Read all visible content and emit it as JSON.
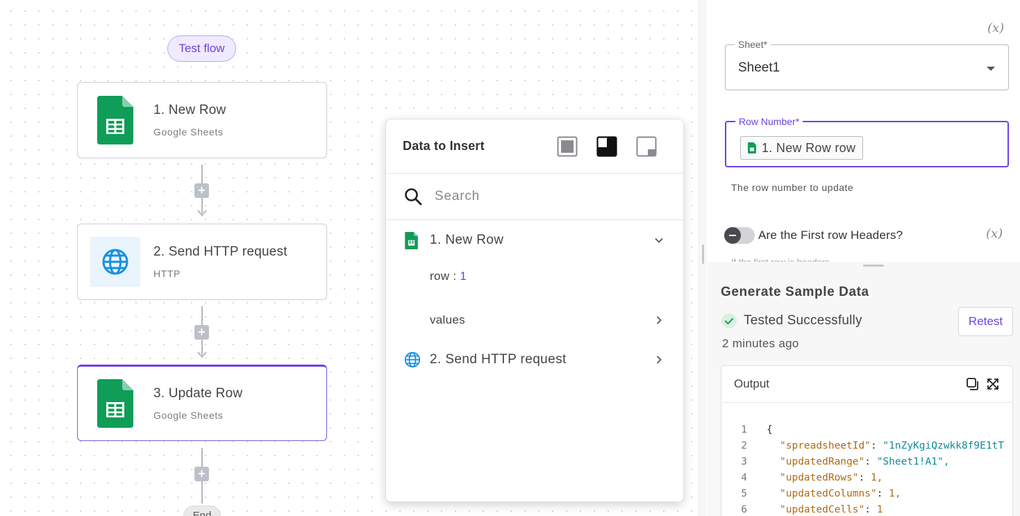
{
  "canvas": {
    "test_flow_label": "Test flow",
    "end_label": "End",
    "steps": [
      {
        "title": "1. New Row",
        "subtitle": "Google Sheets",
        "icon": "google-sheets-icon"
      },
      {
        "title": "2. Send HTTP request",
        "subtitle": "HTTP",
        "icon": "globe-icon"
      },
      {
        "title": "3. Update Row",
        "subtitle": "Google Sheets",
        "icon": "google-sheets-icon"
      }
    ]
  },
  "popup": {
    "title": "Data to Insert",
    "search_placeholder": "Search",
    "tree": [
      {
        "label": "1. New Row",
        "expanded": true,
        "children": [
          {
            "key": "row",
            "value": "1"
          },
          {
            "key": "values",
            "value": ""
          }
        ]
      },
      {
        "label": "2. Send HTTP request",
        "expanded": false
      }
    ]
  },
  "panel": {
    "fx_label": "(x)",
    "sheet": {
      "label": "Sheet*",
      "value": "Sheet1"
    },
    "row_number": {
      "label": "Row Number*",
      "chip": "1. New Row row",
      "hint": "The row number to update"
    },
    "first_row_headers": {
      "label": "Are the First row Headers?",
      "enabled": false
    },
    "cut_text": "If the first row is headers"
  },
  "sample": {
    "title": "Generate Sample Data",
    "status": "Tested Successfully",
    "time_ago": "2 minutes ago",
    "retest_label": "Retest",
    "output_label": "Output",
    "code_lines": [
      {
        "n": "1",
        "key": "",
        "value": "{"
      },
      {
        "n": "2",
        "key": "\"spreadsheetId\"",
        "value": "\"1nZyKgiQzwkk8f9E1tT"
      },
      {
        "n": "3",
        "key": "\"updatedRange\"",
        "value": "\"Sheet1!A1\","
      },
      {
        "n": "4",
        "key": "\"updatedRows\"",
        "value": "1,"
      },
      {
        "n": "5",
        "key": "\"updatedColumns\"",
        "value": "1,"
      },
      {
        "n": "6",
        "key": "\"updatedCells\"",
        "value": "1"
      }
    ]
  },
  "colors": {
    "accent": "#6e41e2",
    "sheets_green": "#0f9d58",
    "http_blue": "#1a8fe0",
    "success_green": "#2e9e5b"
  }
}
